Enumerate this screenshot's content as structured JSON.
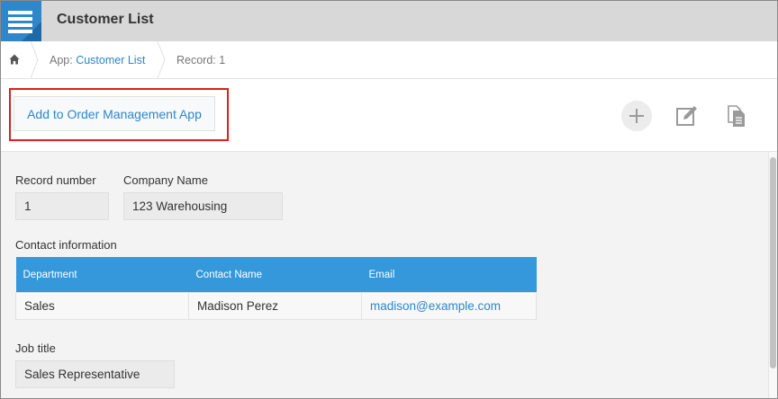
{
  "header": {
    "title": "Customer List"
  },
  "breadcrumb": {
    "app_prefix": "App:",
    "app_link": "Customer List",
    "record": "Record: 1"
  },
  "actions": {
    "add_to_order_label": "Add to Order Management App",
    "icons": [
      "plus-icon",
      "edit-icon",
      "duplicate-icon"
    ]
  },
  "record": {
    "record_number_label": "Record number",
    "record_number_value": "1",
    "company_name_label": "Company Name",
    "company_name_value": "123 Warehousing",
    "contact_info_label": "Contact information",
    "contact_table": {
      "columns": [
        "Department",
        "Contact Name",
        "Email"
      ],
      "rows": [
        [
          "Sales",
          "Madison Perez",
          "madison@example.com"
        ]
      ]
    },
    "job_title_label": "Job title",
    "job_title_value": "Sales Representative"
  },
  "colors": {
    "accent": "#3498db",
    "link": "#2f86c8",
    "highlight": "#e01e1e"
  }
}
